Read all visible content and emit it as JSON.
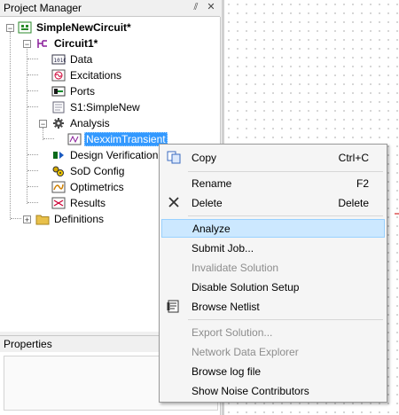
{
  "project_manager": {
    "title": "Project Manager",
    "pin_glyph": "⫽",
    "close_glyph": "✕"
  },
  "tree": {
    "project": "SimpleNewCircuit*",
    "design": "Circuit1*",
    "items": {
      "data": "Data",
      "excitations": "Excitations",
      "ports": "Ports",
      "schematic": "S1:SimpleNew",
      "analysis": "Analysis",
      "setup": "NexximTransient",
      "design_verification": "Design Verification",
      "sod_config": "SoD Config",
      "optimetrics": "Optimetrics",
      "results": "Results",
      "definitions": "Definitions"
    },
    "expander_minus": "−",
    "expander_plus": "+"
  },
  "properties": {
    "title": "Properties",
    "close_glyph": "✕"
  },
  "context_menu": {
    "copy": {
      "label": "Copy",
      "shortcut": "Ctrl+C"
    },
    "rename": {
      "label": "Rename",
      "shortcut": "F2"
    },
    "delete": {
      "label": "Delete",
      "shortcut": "Delete"
    },
    "analyze": {
      "label": "Analyze"
    },
    "submit_job": {
      "label": "Submit Job..."
    },
    "invalidate_solution": {
      "label": "Invalidate Solution"
    },
    "disable_solution_setup": {
      "label": "Disable Solution Setup"
    },
    "browse_netlist": {
      "label": "Browse Netlist"
    },
    "export_solution": {
      "label": "Export Solution..."
    },
    "network_data_explorer": {
      "label": "Network Data Explorer"
    },
    "browse_log_file": {
      "label": "Browse log file"
    },
    "show_noise_contributors": {
      "label": "Show Noise Contributors"
    }
  },
  "colors": {
    "selection": "#3399ff",
    "menu_highlight": "#cce8ff",
    "disabled_text": "#8d8d8d"
  }
}
